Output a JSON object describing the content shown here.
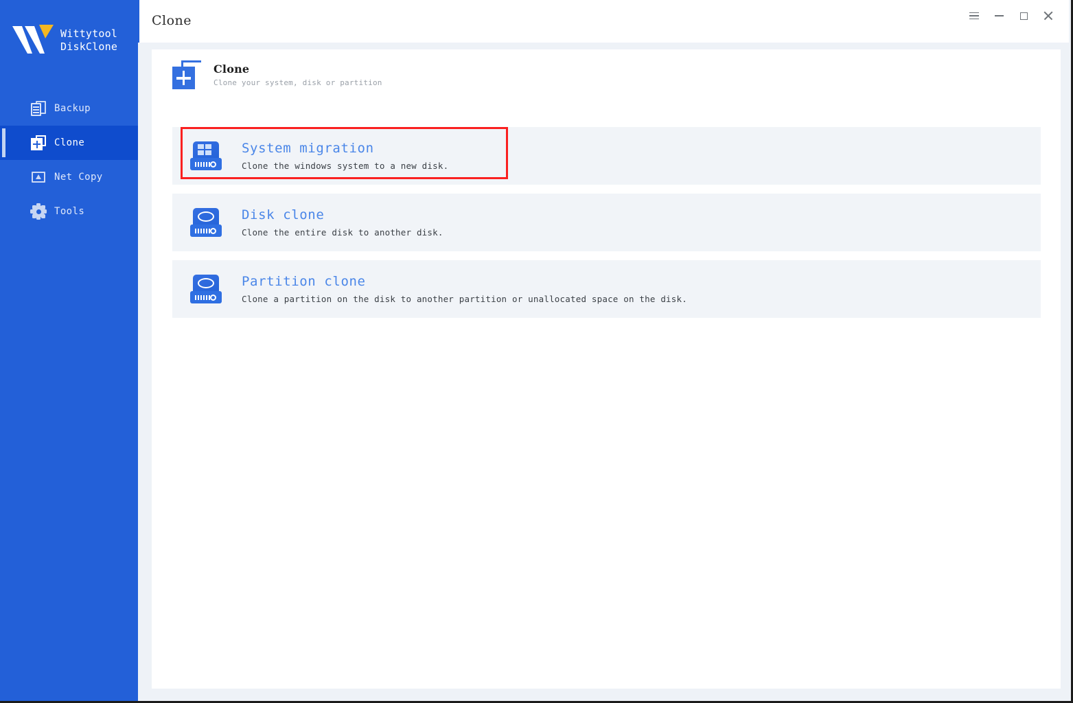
{
  "app": {
    "brand_line1": "Wittytool",
    "brand_line2": "DiskClone",
    "logo_icon": "wittytool-w-logo"
  },
  "titlebar": {
    "title": "Clone",
    "buttons": [
      {
        "name": "menu-button",
        "icon": "hamburger-menu-icon"
      },
      {
        "name": "minimize-button",
        "icon": "minimize-icon"
      },
      {
        "name": "maximize-button",
        "icon": "maximize-icon"
      },
      {
        "name": "close-button",
        "icon": "close-icon"
      }
    ]
  },
  "sidebar": {
    "items": [
      {
        "label": "Backup",
        "icon": "backup-pages-icon",
        "active": false
      },
      {
        "label": "Clone",
        "icon": "clone-squares-plus-icon",
        "active": true
      },
      {
        "label": "Net Copy",
        "icon": "net-copy-icon",
        "active": false
      },
      {
        "label": "Tools",
        "icon": "gear-icon",
        "active": false
      }
    ]
  },
  "header": {
    "title": "Clone",
    "subtitle": "Clone your system, disk or partition",
    "icon": "clone-squares-plus-icon"
  },
  "options": [
    {
      "title": "System migration",
      "desc": "Clone the windows system to a new disk.",
      "icon": "windows-drive-icon",
      "highlighted": true
    },
    {
      "title": "Disk clone",
      "desc": "Clone the entire disk to another disk.",
      "icon": "disk-drive-icon",
      "highlighted": false
    },
    {
      "title": "Partition clone",
      "desc": "Clone a partition on the disk to another partition or unallocated space on the disk.",
      "icon": "disk-drive-icon",
      "highlighted": false
    }
  ],
  "colors": {
    "sidebar_blue": "#2360d8",
    "sidebar_active_blue": "#0f4ccd",
    "accent_link_blue": "#4a86e8",
    "highlight_red": "#fa2020",
    "card_bg": "#f1f4f8",
    "page_bg": "#eef2f7",
    "logo_accent_yellow": "#f5b721"
  }
}
